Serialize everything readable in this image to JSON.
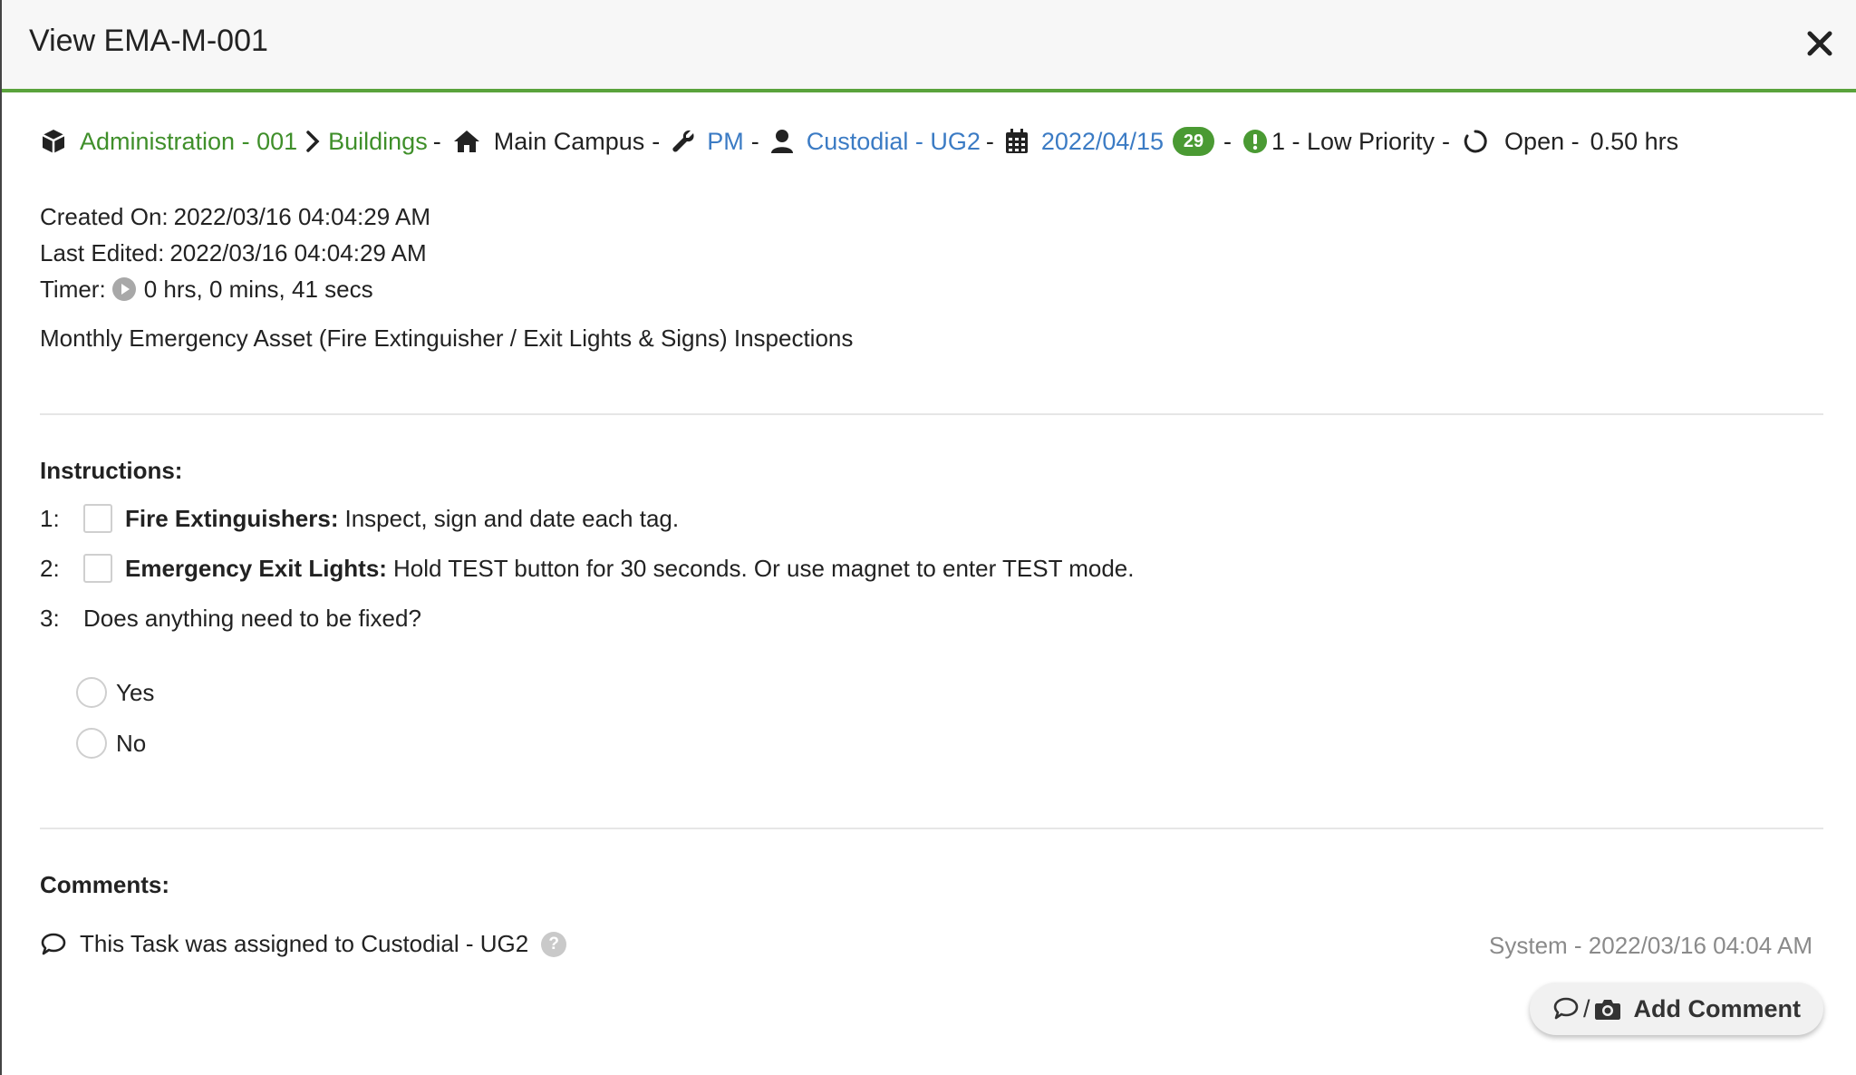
{
  "modal": {
    "title": "View EMA-M-001"
  },
  "breadcrumb": {
    "location": "Administration - 001",
    "building": "Buildings",
    "dash1": "-",
    "campus": "Main Campus",
    "dash2": "-",
    "type": "PM",
    "dash3": "-",
    "assignee": "Custodial - UG2",
    "dash4": "-",
    "date": "2022/04/15",
    "days_badge": "29",
    "dash5": "-",
    "priority": "1 - Low Priority",
    "dash6": "-",
    "status": "Open -",
    "hours": "0.50 hrs"
  },
  "meta": {
    "created_label": "Created On:",
    "created_value": "2022/03/16 04:04:29 AM",
    "edited_label": "Last Edited:",
    "edited_value": "2022/03/16 04:04:29 AM",
    "timer_label": "Timer:",
    "timer_value": "0 hrs, 0 mins, 41 secs"
  },
  "description": "Monthly Emergency Asset (Fire Extinguisher / Exit Lights & Signs) Inspections",
  "instructions": {
    "title": "Instructions:",
    "items": [
      {
        "num": "1:",
        "bold": "Fire Extinguishers:",
        "text": "Inspect, sign and date each tag."
      },
      {
        "num": "2:",
        "bold": "Emergency Exit Lights:",
        "text": "Hold TEST button for 30 seconds. Or use magnet to enter TEST mode."
      },
      {
        "num": "3:",
        "text": "Does anything need to be fixed?"
      }
    ],
    "options": [
      "Yes",
      "No"
    ]
  },
  "comments": {
    "title": "Comments:",
    "items": [
      {
        "text": "This Task was assigned to Custodial - UG2",
        "meta": "System - 2022/03/16 04:04 AM"
      }
    ],
    "add_slash": "/",
    "add_label": "Add Comment"
  },
  "colors": {
    "accent_green": "#5aa33c",
    "link_blue": "#3b7bc4",
    "badge_green": "#4a9a33"
  }
}
